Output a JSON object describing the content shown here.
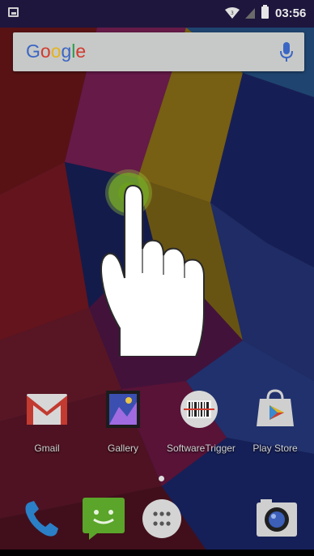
{
  "status_bar": {
    "time": "03:56",
    "icons": [
      "notification-icon",
      "wifi-icon",
      "signal-icon",
      "battery-icon"
    ]
  },
  "search_bar": {
    "logo_letters": [
      "G",
      "o",
      "o",
      "g",
      "l",
      "e"
    ],
    "logo_colors": [
      "#3b66c4",
      "#d23b2f",
      "#e5b31d",
      "#3b66c4",
      "#2e9b4a",
      "#d23b2f"
    ],
    "mic_color": "#3b66c4"
  },
  "gesture_hint": {
    "icons": [
      "touch-ring-icon",
      "pointing-hand-icon"
    ],
    "ring_color": "#6a9d20"
  },
  "home_apps": [
    {
      "label": "Gmail",
      "icon": "gmail-icon"
    },
    {
      "label": "Gallery",
      "icon": "gallery-icon"
    },
    {
      "label": "SoftwareTrigger",
      "icon": "barcode-scanner-icon"
    },
    {
      "label": "Play Store",
      "icon": "play-store-icon"
    }
  ],
  "dock": [
    {
      "icon": "phone-icon"
    },
    {
      "icon": "messaging-icon"
    },
    {
      "icon": "app-drawer-icon"
    },
    {
      "icon": "camera-icon"
    }
  ],
  "home_page_indicator": {
    "page_count": 1,
    "current_page": 1
  }
}
